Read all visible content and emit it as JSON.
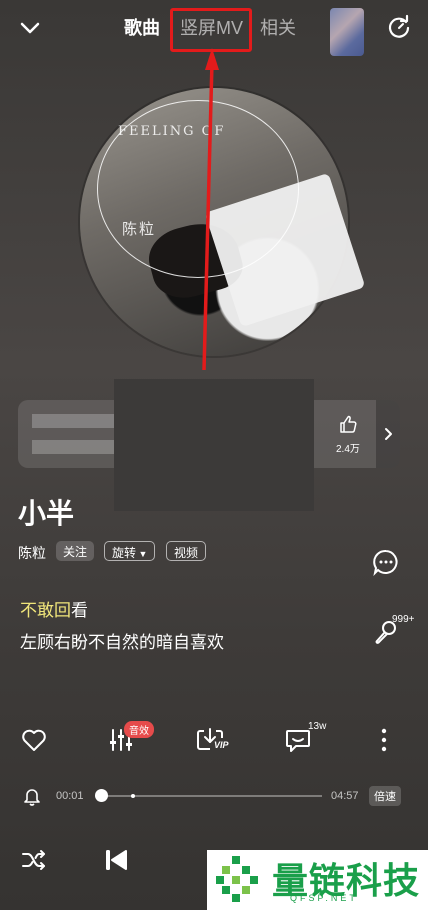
{
  "header": {
    "tabs": [
      {
        "label": "歌曲",
        "active": true
      },
      {
        "label": "竖屏MV",
        "active": false,
        "highlighted": true
      },
      {
        "label": "相关",
        "active": false
      }
    ]
  },
  "album_art": {
    "text_lines": [
      "FEELING OF",
      "陈粒"
    ]
  },
  "card": {
    "like_count": "2.4万"
  },
  "song": {
    "title": "小半",
    "artist": "陈粒",
    "follow_label": "关注",
    "spin_label": "旋转",
    "video_label": "视频"
  },
  "lyrics": {
    "current_highlight": "不敢回",
    "current_rest": "看",
    "next": "左顾右盼不自然的暗自喜欢"
  },
  "side": {
    "singing_count": "999+"
  },
  "actions": {
    "effect_badge": "音效",
    "vip_label": "VIP",
    "comment_count": "13w"
  },
  "player": {
    "current_time": "00:01",
    "total_time": "04:57",
    "speed_label": "倍速",
    "progress": 0.0034
  },
  "watermark": {
    "title": "量链科技",
    "subtitle": "QFSP.NET"
  },
  "colors": {
    "highlight_box": "#e31b1b",
    "lyric_highlight": "#f0e57a",
    "badge_red": "#e64b4b",
    "watermark_green": "#1a9f4a"
  }
}
